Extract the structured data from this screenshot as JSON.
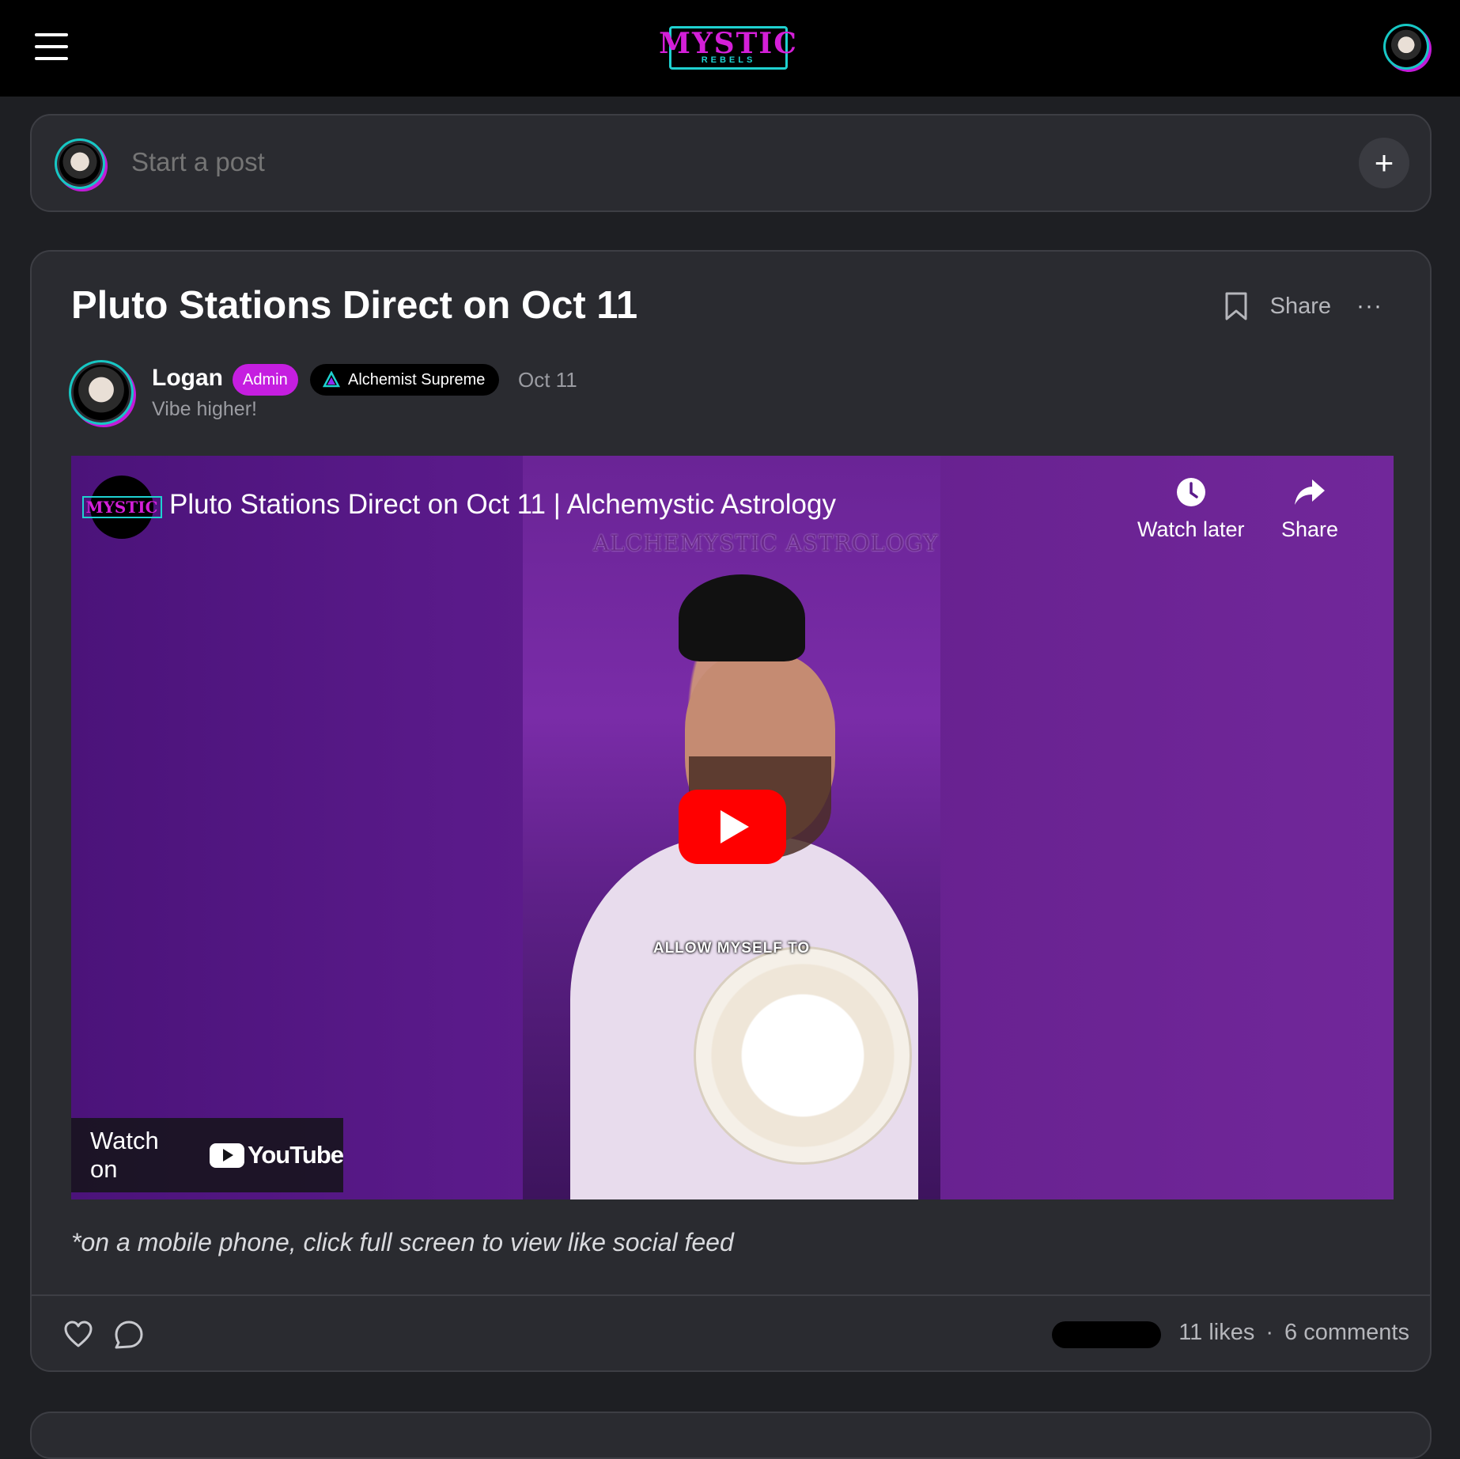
{
  "header": {
    "logo_main": "MYSTIC",
    "logo_sub": "REBELS"
  },
  "composer": {
    "placeholder": "Start a post",
    "add_label": "+"
  },
  "post": {
    "title": "Pluto Stations Direct on Oct 11",
    "share_label": "Share",
    "more_label": "···",
    "author": {
      "name": "Logan",
      "role_badge": "Admin",
      "rank_badge": "Alchemist Supreme",
      "date": "Oct 11",
      "tagline": "Vibe higher!"
    },
    "video": {
      "channel_logo": "MYSTIC",
      "title": "Pluto Stations Direct on Oct 11 | Alchemystic Astrology",
      "watermark": "ALCHEMYSTIC ASTROLOGY",
      "overlay_caption": "ALLOW MYSELF TO",
      "watch_later_label": "Watch later",
      "share_label": "Share",
      "watch_on_label": "Watch on",
      "youtube_label": "YouTube"
    },
    "caption": "*on a mobile phone, click full screen to view like social feed",
    "stats": {
      "likes": "11 likes",
      "separator": "·",
      "comments": "6 comments"
    }
  },
  "colors": {
    "accent_magenta": "#c51ee0",
    "accent_cyan": "#1fd1d0",
    "youtube_red": "#ff0000"
  }
}
